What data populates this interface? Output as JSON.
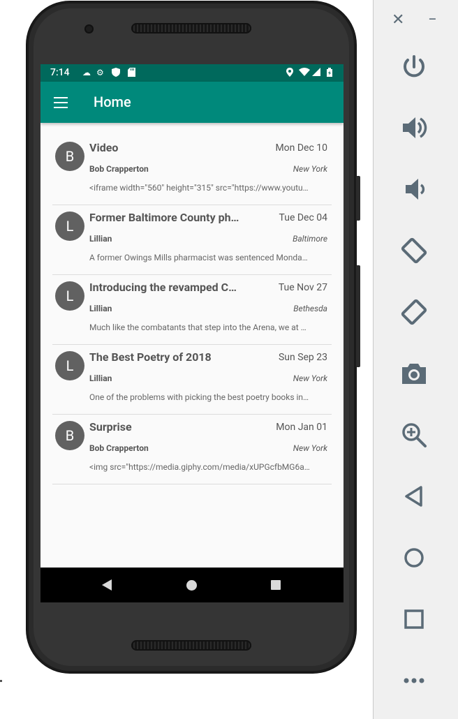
{
  "status_bar": {
    "time": "7:14"
  },
  "app_bar": {
    "title": "Home"
  },
  "posts": [
    {
      "avatar": "B",
      "title": "Video",
      "date": "Mon Dec 10",
      "author": "Bob Crapperton",
      "location": "New York",
      "snippet": "<iframe width=\"560\" height=\"315\" src=\"https://www.youtu…"
    },
    {
      "avatar": "L",
      "title": "Former Baltimore County ph…",
      "date": "Tue Dec 04",
      "author": "Lillian",
      "location": "Baltimore",
      "snippet": "A former Owings Mills pharmacist was sentenced Monda…"
    },
    {
      "avatar": "L",
      "title": "Introducing the revamped C…",
      "date": "Tue Nov 27",
      "author": "Lillian",
      "location": "Bethesda",
      "snippet": "Much like the combatants that step into the Arena, we at …"
    },
    {
      "avatar": "L",
      "title": "The Best Poetry of 2018",
      "date": "Sun Sep 23",
      "author": "Lillian",
      "location": "New York",
      "snippet": "One of the problems with picking the best poetry books in…"
    },
    {
      "avatar": "B",
      "title": "Surprise",
      "date": "Mon Jan 01",
      "author": "Bob Crapperton",
      "location": "New York",
      "snippet": "<img src=\"https://media.giphy.com/media/xUPGcfbMG6a…"
    }
  ],
  "emulator_toolbar": {
    "close_glyph": "✕",
    "minimize_glyph": "−",
    "icons": [
      "power-icon",
      "volume-up-icon",
      "volume-down-icon",
      "rotate-left-icon",
      "rotate-right-icon",
      "camera-icon",
      "zoom-icon",
      "back-icon",
      "home-icon",
      "overview-icon",
      "more-icon"
    ]
  },
  "colors": {
    "primary": "#00897b",
    "primary_dark": "#00695c",
    "avatar": "#616161",
    "toolbar_icon": "#5b6b77"
  }
}
